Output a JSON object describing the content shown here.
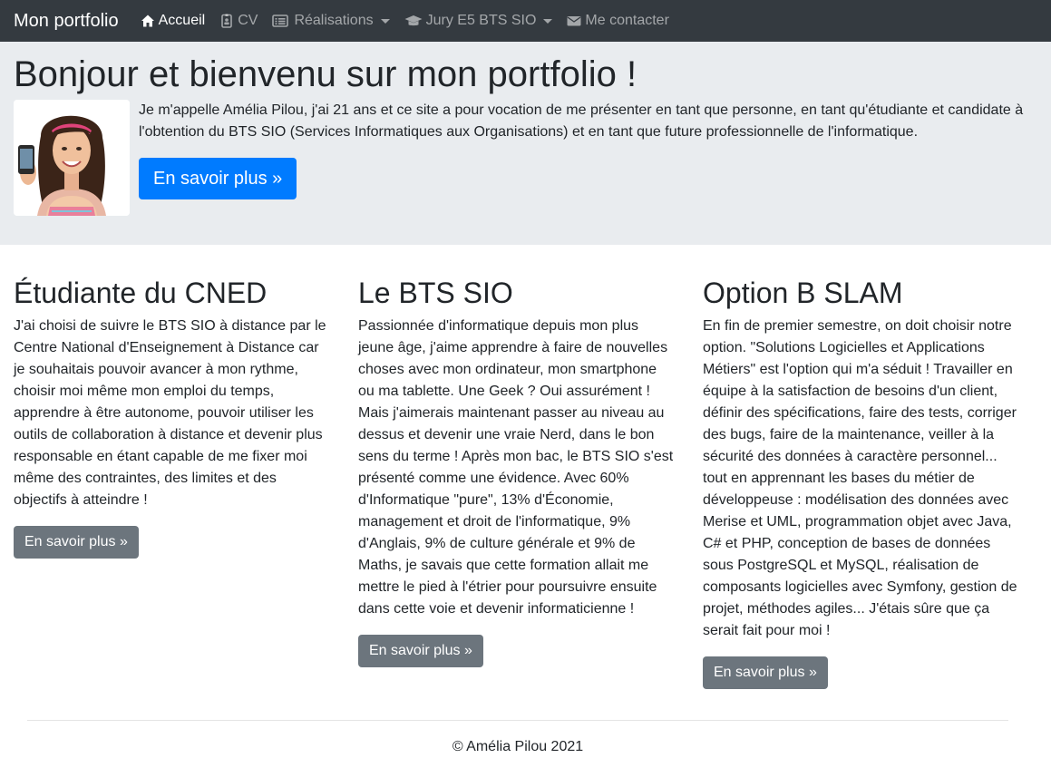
{
  "navbar": {
    "brand": "Mon portfolio",
    "background": "#343a40",
    "items": [
      {
        "label": "Accueil",
        "icon": "home-icon",
        "active": true,
        "dropdown": false
      },
      {
        "label": "CV",
        "icon": "id-badge-icon",
        "active": false,
        "dropdown": false
      },
      {
        "label": "Réalisations",
        "icon": "list-alt-icon",
        "active": false,
        "dropdown": true
      },
      {
        "label": "Jury E5 BTS SIO",
        "icon": "graduation-cap-icon",
        "active": false,
        "dropdown": true
      },
      {
        "label": "Me contacter",
        "icon": "envelope-icon",
        "active": false,
        "dropdown": false
      }
    ]
  },
  "jumbotron": {
    "title": "Bonjour et bienvenu sur mon portfolio !",
    "text": "Je m'appelle Amélia Pilou, j'ai 21 ans et ce site a pour vocation de me présenter en tant que personne, en tant qu'étudiante et candidate à l'obtention du BTS SIO (Services Informatiques aux Organisations) et en tant que future professionnelle de l'informatique.",
    "button_label": "En savoir plus »",
    "background": "#e9ecef",
    "button_color": "#007bff"
  },
  "columns": [
    {
      "title": "Étudiante du CNED",
      "text": "J'ai choisi de suivre le BTS SIO à distance par le Centre National d'Enseignement à Distance car je souhaitais pouvoir avancer à mon rythme, choisir moi même mon emploi du temps, apprendre à être autonome, pouvoir utiliser les outils de collaboration à distance et devenir plus responsable en étant capable de me fixer moi même des contraintes, des limites et des objectifs à atteindre !",
      "button_label": "En savoir plus »"
    },
    {
      "title": "Le BTS SIO",
      "text": "Passionnée d'informatique depuis mon plus jeune âge, j'aime apprendre à faire de nouvelles choses avec mon ordinateur, mon smartphone ou ma tablette. Une Geek ? Oui assurément ! Mais j'aimerais maintenant passer au niveau au dessus et devenir une vraie Nerd, dans le bon sens du terme ! Après mon bac, le BTS SIO s'est présenté comme une évidence. Avec 60% d'Informatique \"pure\", 13% d'Économie, management et droit de l'informatique, 9% d'Anglais, 9% de culture générale et 9% de Maths, je savais que cette formation allait me mettre le pied à l'étrier pour poursuivre ensuite dans cette voie et devenir informaticienne !",
      "button_label": "En savoir plus »"
    },
    {
      "title": "Option B SLAM",
      "text": "En fin de premier semestre, on doit choisir notre option. \"Solutions Logicielles et Applications Métiers\" est l'option qui m'a séduit ! Travailler en équipe à la satisfaction de besoins d'un client, définir des spécifications, faire des tests, corriger des bugs, faire de la maintenance, veiller à la sécurité des données à caractère personnel... tout en apprennant les bases du métier de développeuse : modélisation des données avec Merise et UML, programmation objet avec Java, C# et PHP, conception de bases de données sous PostgreSQL et MySQL, réalisation de composants logicielles avec Symfony, gestion de projet, méthodes agiles... J'étais sûre que ça serait fait pour moi !",
      "button_label": "En savoir plus »"
    }
  ],
  "footer": {
    "text": "© Amélia Pilou 2021"
  }
}
